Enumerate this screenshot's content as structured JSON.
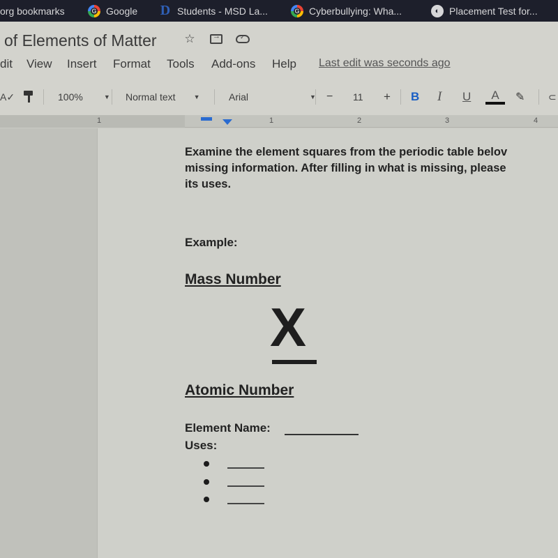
{
  "bookmarks": {
    "items": [
      {
        "label": "org bookmarks",
        "icon": "folder-icon"
      },
      {
        "label": "Google",
        "icon": "google-icon"
      },
      {
        "label": "Students - MSD La...",
        "icon": "district-logo-icon"
      },
      {
        "label": "Cyberbullying: Wha...",
        "icon": "google-icon"
      },
      {
        "label": "Placement Test for...",
        "icon": "globe-icon"
      }
    ]
  },
  "document": {
    "title": "of Elements of Matter",
    "title_icons": [
      "star-icon",
      "move-to-folder-icon",
      "cloud-saved-icon"
    ],
    "last_edit": "Last edit was seconds ago"
  },
  "menu": {
    "items": [
      "dit",
      "View",
      "Insert",
      "Format",
      "Tools",
      "Add-ons",
      "Help"
    ]
  },
  "toolbar": {
    "spellcheck_icon": "spellcheck-icon",
    "paint_format_icon": "paint-format-icon",
    "zoom": "100%",
    "style": "Normal text",
    "font": "Arial",
    "font_size": "11",
    "minus": "−",
    "plus": "+",
    "bold": "B",
    "italic": "I",
    "underline": "U",
    "text_color": "A",
    "text_color_value": "#111111",
    "highlight_icon": "highlight-pen-icon",
    "link_icon": "link-icon"
  },
  "ruler": {
    "numbers": [
      "1",
      "1",
      "2",
      "3",
      "4"
    ]
  },
  "content": {
    "instructions": [
      "Examine the element squares from the periodic table belov",
      "missing information. After filling in what is missing, please",
      "its uses."
    ],
    "example_label": "Example:",
    "mass_number": "Mass Number",
    "symbol": "X",
    "atomic_number": "Atomic Number",
    "element_name_label": "Element Name:",
    "uses_label": "Uses:",
    "uses_count": 3
  }
}
